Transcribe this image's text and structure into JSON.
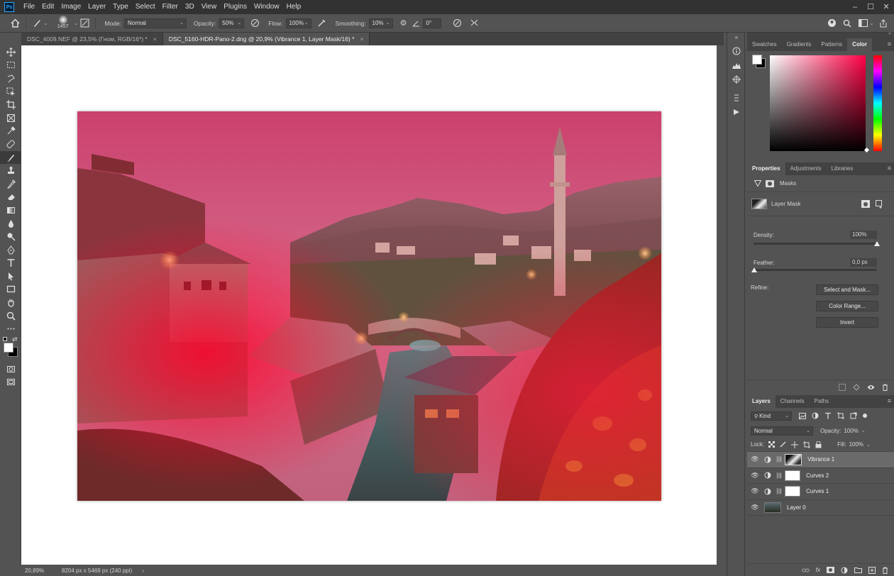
{
  "app": {
    "logo": "Ps",
    "menu": [
      "File",
      "Edit",
      "Image",
      "Layer",
      "Type",
      "Select",
      "Filter",
      "3D",
      "View",
      "Plugins",
      "Window",
      "Help"
    ]
  },
  "window_controls": {
    "minimize": "–",
    "restore": "☐",
    "close": "✕"
  },
  "options_bar": {
    "brush_size": "1457",
    "mode_label": "Mode:",
    "mode_value": "Normal",
    "opacity_label": "Opacity:",
    "opacity_value": "50%",
    "flow_label": "Flow:",
    "flow_value": "100%",
    "smoothing_label": "Smoothing:",
    "smoothing_value": "10%",
    "angle_value": "0°"
  },
  "document_tabs": [
    {
      "label": "DSC_4009.NEF @ 23,5% (Гном, RGB/16*) *",
      "close": "×",
      "active": false
    },
    {
      "label": "DSC_5160-HDR-Pano-2.dng @ 20,9% (Vibrance 1, Layer Mask/16) *",
      "close": "×",
      "active": true
    }
  ],
  "status_bar": {
    "zoom": "20,89%",
    "doc_info": "8204 px x 5469 px (240 ppi)",
    "arrow": "›"
  },
  "color_panel": {
    "tabs": [
      "Swatches",
      "Gradients",
      "Patterns",
      "Color"
    ],
    "active_tab": "Color",
    "hue_color": "#ff0044"
  },
  "properties_panel": {
    "tabs": [
      "Properties",
      "Adjustments",
      "Libraries"
    ],
    "active_tab": "Properties",
    "section": "Masks",
    "mask_name": "Layer Mask",
    "density_label": "Density:",
    "density_value": "100%",
    "feather_label": "Feather:",
    "feather_value": "0,0 px",
    "refine_label": "Refine:",
    "buttons": [
      "Select and Mask...",
      "Color Range...",
      "Invert"
    ]
  },
  "layers_panel": {
    "tabs": [
      "Layers",
      "Channels",
      "Paths"
    ],
    "active_tab": "Layers",
    "filter_kind": "Kind",
    "blend_mode": "Normal",
    "opacity_label": "Opacity:",
    "opacity_value": "100%",
    "lock_label": "Lock:",
    "fill_label": "Fill:",
    "fill_value": "100%",
    "layers": [
      {
        "name": "Vibrance 1",
        "selected": true
      },
      {
        "name": "Curves 2",
        "selected": false
      },
      {
        "name": "Curves 1",
        "selected": false
      },
      {
        "name": "Layer 0",
        "selected": false
      }
    ]
  },
  "colors": {
    "accent": "#31a8ff",
    "mask_overlay": "#ff0030",
    "app_bg": "#535353",
    "menubar": "#323232"
  }
}
